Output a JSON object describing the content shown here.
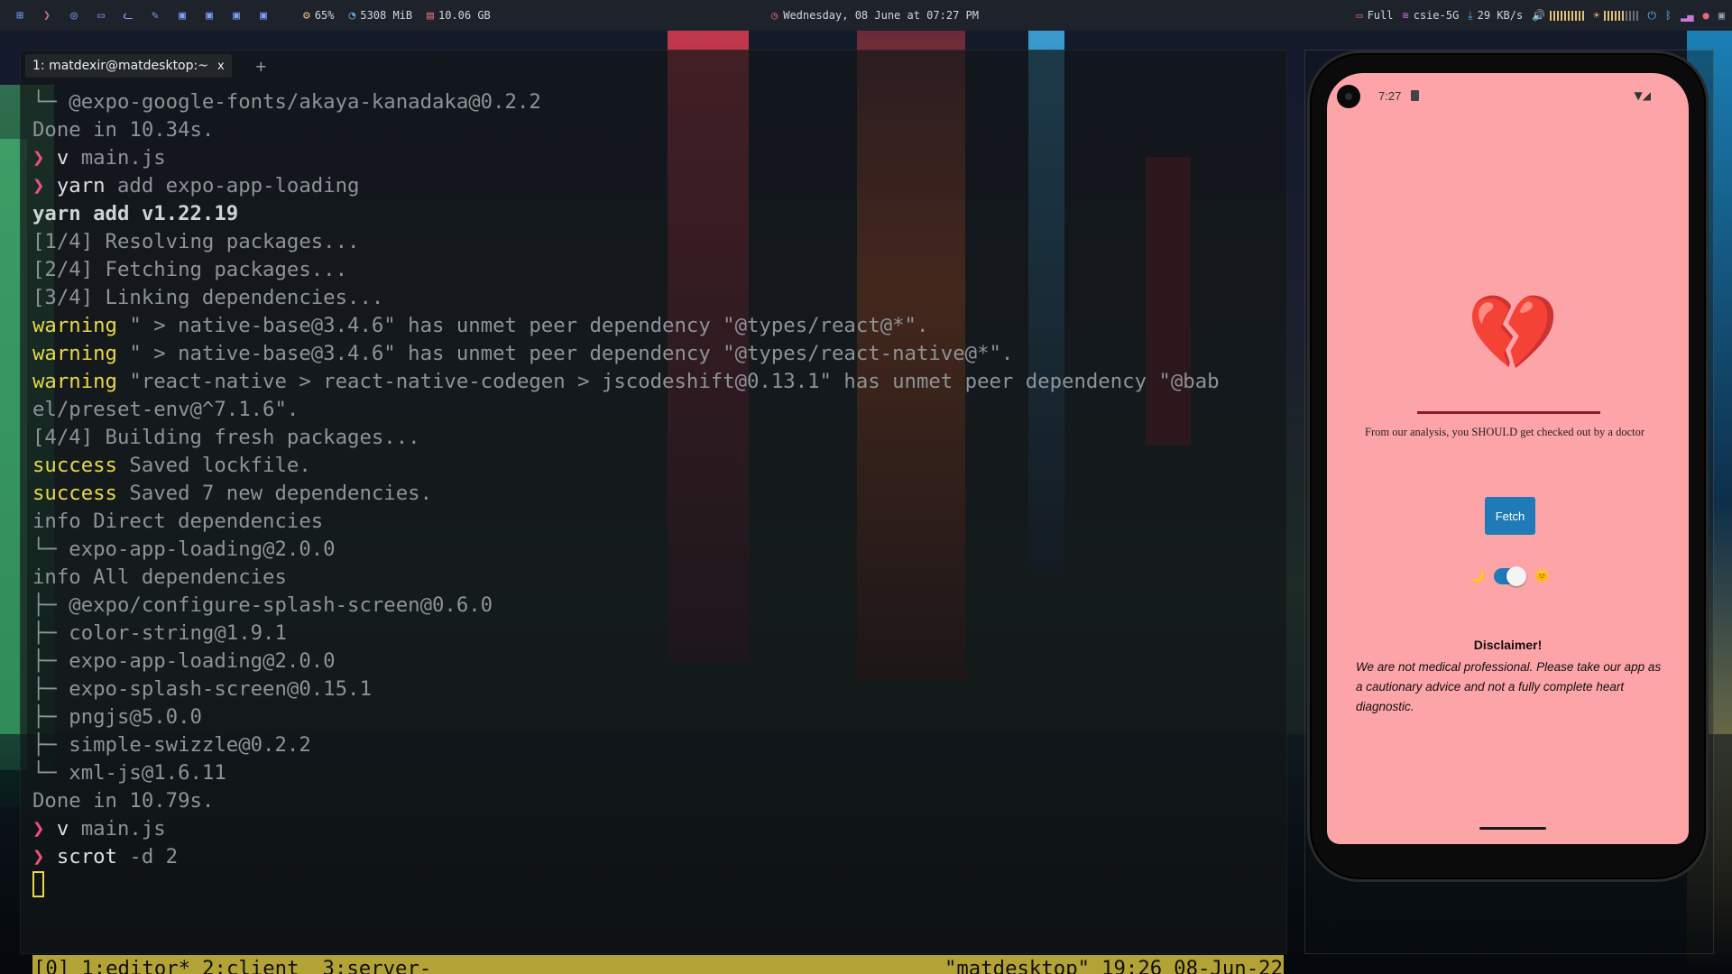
{
  "topbar": {
    "launcher_icons": [
      "grid-icon",
      "terminal-icon",
      "browser-icon",
      "folder-icon",
      "cat-icon",
      "edit-icon",
      "monitor-icon-1",
      "monitor-icon-2",
      "monitor-icon-3",
      "monitor-icon-4"
    ],
    "cpu": "65%",
    "memory": "5308 MiB",
    "disk": "10.06 GB",
    "datetime": "Wednesday, 08 June at 07:27 PM",
    "battery": "Full",
    "wifi": "csie-5G",
    "download": "29 KB/s"
  },
  "terminal": {
    "tab_title": "1: matdexir@matdesktop:~",
    "tab_close": "x",
    "new_tab": "+",
    "lines": [
      {
        "type": "plain",
        "text": "└─ @expo-google-fonts/akaya-kanadaka@0.2.2"
      },
      {
        "type": "plain",
        "text": "Done in 10.34s."
      },
      {
        "type": "prompt",
        "prompt": "❯ ",
        "cmd": "v",
        "arg": " main.js"
      },
      {
        "type": "prompt",
        "prompt": "❯ ",
        "cmd": "yarn",
        "arg": " add expo-app-loading"
      },
      {
        "type": "bold",
        "text": "yarn add v1.22.19"
      },
      {
        "type": "plain",
        "text": "[1/4] Resolving packages..."
      },
      {
        "type": "plain",
        "text": "[2/4] Fetching packages..."
      },
      {
        "type": "plain",
        "text": "[3/4] Linking dependencies..."
      },
      {
        "type": "tagged",
        "tag": "warning",
        "text": " \" > native-base@3.4.6\" has unmet peer dependency \"@types/react@*\"."
      },
      {
        "type": "tagged",
        "tag": "warning",
        "text": " \" > native-base@3.4.6\" has unmet peer dependency \"@types/react-native@*\"."
      },
      {
        "type": "tagged",
        "tag": "warning",
        "text": " \"react-native > react-native-codegen > jscodeshift@0.13.1\" has unmet peer dependency \"@bab"
      },
      {
        "type": "plain",
        "text": "el/preset-env@^7.1.6\"."
      },
      {
        "type": "plain",
        "text": "[4/4] Building fresh packages..."
      },
      {
        "type": "tagged",
        "tag": "success",
        "text": " Saved lockfile."
      },
      {
        "type": "tagged",
        "tag": "success",
        "text": " Saved 7 new dependencies."
      },
      {
        "type": "plain",
        "text": "info Direct dependencies"
      },
      {
        "type": "plain",
        "text": "└─ expo-app-loading@2.0.0"
      },
      {
        "type": "plain",
        "text": "info All dependencies"
      },
      {
        "type": "plain",
        "text": "├─ @expo/configure-splash-screen@0.6.0"
      },
      {
        "type": "plain",
        "text": "├─ color-string@1.9.1"
      },
      {
        "type": "plain",
        "text": "├─ expo-app-loading@2.0.0"
      },
      {
        "type": "plain",
        "text": "├─ expo-splash-screen@0.15.1"
      },
      {
        "type": "plain",
        "text": "├─ pngjs@5.0.0"
      },
      {
        "type": "plain",
        "text": "├─ simple-swizzle@0.2.2"
      },
      {
        "type": "plain",
        "text": "└─ xml-js@1.6.11"
      },
      {
        "type": "plain",
        "text": "Done in 10.79s."
      },
      {
        "type": "prompt",
        "prompt": "❯ ",
        "cmd": "v",
        "arg": " main.js"
      },
      {
        "type": "prompt",
        "prompt": "❯ ",
        "cmd": "scrot",
        "arg": " -d 2"
      }
    ]
  },
  "tmux": {
    "session": "[0]",
    "windows": [
      "1:editor*",
      "2:client",
      "3:server-"
    ],
    "host": "\"matdesktop\"",
    "time": "19:26",
    "date": "08-Jun-22"
  },
  "phone": {
    "time": "7:27",
    "heart_emoji": "💔",
    "analysis_text": "From our analysis, you SHOULD get checked out by a doctor",
    "fetch_label": "Fetch",
    "moon_emoji": "🌙",
    "sun_emoji": "🌞",
    "toggle_on": true,
    "disclaimer_title": "Disclaimer!",
    "disclaimer_body": "We are not medical professional. Please take our app as a cautionary advice and not a fully complete heart diagnostic."
  },
  "colors": {
    "phone_background": "#fda4a9",
    "button_blue": "#1f7ab8",
    "tmux_bar": "#b3a336",
    "warning_yellow": "#e8d84a",
    "prompt_pink": "#f0507e"
  }
}
